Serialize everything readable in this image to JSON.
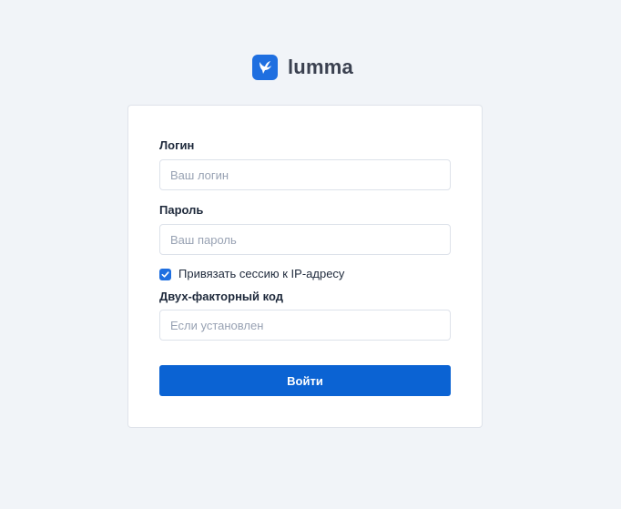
{
  "brand": {
    "name": "lumma",
    "color": "#1f6fe0",
    "icon": "bird-icon"
  },
  "form": {
    "login_label": "Логин",
    "login_placeholder": "Ваш логин",
    "login_value": "",
    "password_label": "Пароль",
    "password_placeholder": "Ваш пароль",
    "password_value": "",
    "bind_ip_label": "Привязать сессию к IP-адресу",
    "bind_ip_checked": true,
    "twofa_label": "Двух-факторный код",
    "twofa_placeholder": "Если установлен",
    "twofa_value": "",
    "submit_label": "Войти"
  },
  "colors": {
    "accent": "#0b63d3",
    "background": "#f1f4f8"
  }
}
